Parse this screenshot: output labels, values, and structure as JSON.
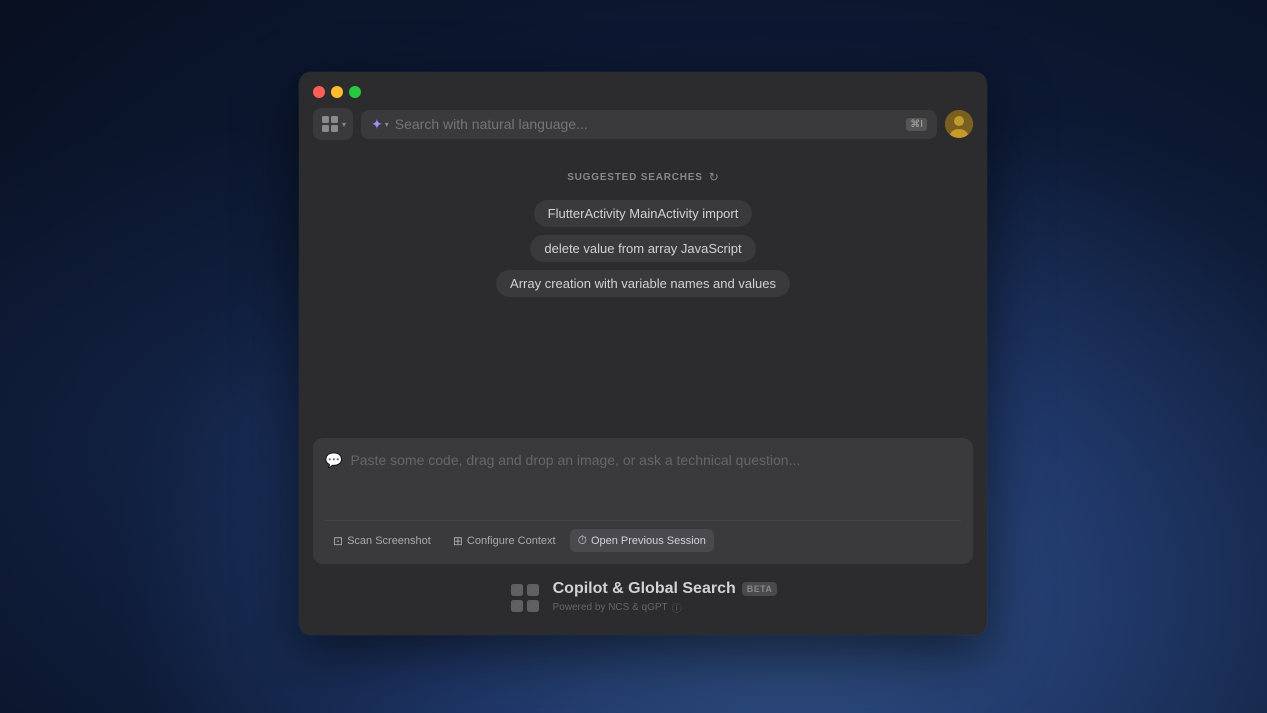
{
  "desktop": {
    "bg_description": "macOS Mojave dark mountain wallpaper"
  },
  "window": {
    "title": "Copilot & Global Search"
  },
  "traffic_lights": {
    "close": "close",
    "minimize": "minimize",
    "maximize": "maximize"
  },
  "search_bar": {
    "placeholder": "Search with natural language...",
    "kbd_shortcut": "⌘I",
    "app_icon_alt": "copilot-icon",
    "ai_icon_alt": "ai-sparkle-icon"
  },
  "suggested": {
    "label": "SUGGESTED SEARCHES",
    "chips": [
      "FlutterActivity MainActivity import",
      "delete value from array JavaScript",
      "Array creation with variable names and values"
    ]
  },
  "chat": {
    "placeholder": "Paste some code, drag and drop an image, or ask a technical question...",
    "actions": [
      {
        "id": "scan-screenshot",
        "label": "Scan Screenshot",
        "icon": "screenshot"
      },
      {
        "id": "configure-context",
        "label": "Configure Context",
        "icon": "context"
      },
      {
        "id": "open-previous-session",
        "label": "Open Previous Session",
        "icon": "session",
        "active": true
      }
    ]
  },
  "footer": {
    "logo_alt": "copilot-logo",
    "title": "Copilot & Global Search",
    "beta_label": "BETA",
    "subtitle": "Powered by NCS & qGPT",
    "info_icon": "info-circle-icon"
  }
}
